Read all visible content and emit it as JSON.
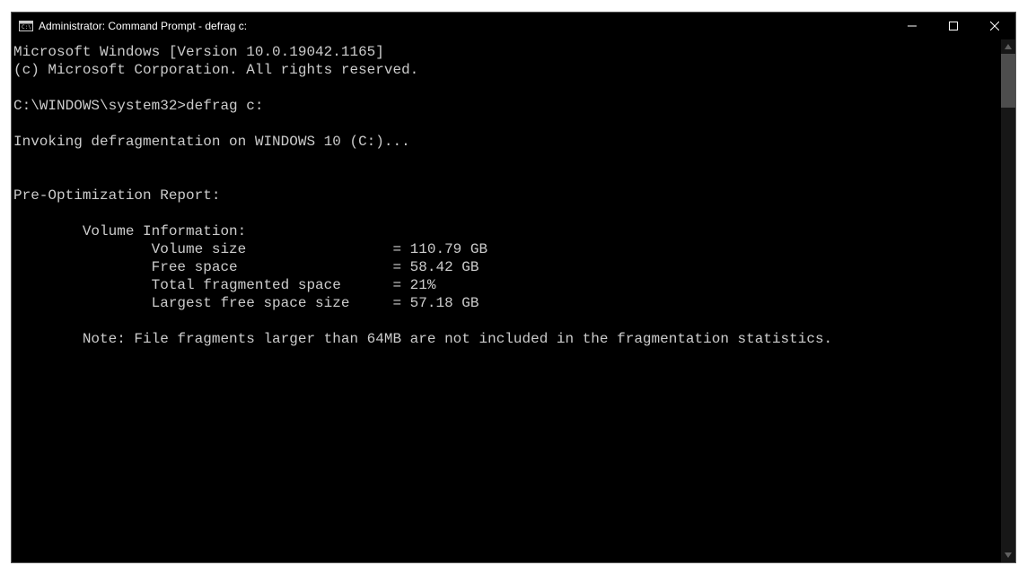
{
  "titlebar": {
    "title": "Administrator: Command Prompt - defrag  c:"
  },
  "console": {
    "line1": "Microsoft Windows [Version 10.0.19042.1165]",
    "line2": "(c) Microsoft Corporation. All rights reserved.",
    "blank1": "",
    "prompt_line": "C:\\WINDOWS\\system32>defrag c:",
    "blank2": "",
    "invoking": "Invoking defragmentation on WINDOWS 10 (C:)...",
    "blank3": "",
    "blank4": "",
    "report_header": "Pre-Optimization Report:",
    "blank5": "",
    "vol_info": "        Volume Information:",
    "vol_size": "                Volume size                 = 110.79 GB",
    "free_space": "                Free space                  = 58.42 GB",
    "frag_space": "                Total fragmented space      = 21%",
    "largest_free": "                Largest free space size     = 57.18 GB",
    "blank6": "",
    "note": "        Note: File fragments larger than 64MB are not included in the fragmentation statistics."
  }
}
